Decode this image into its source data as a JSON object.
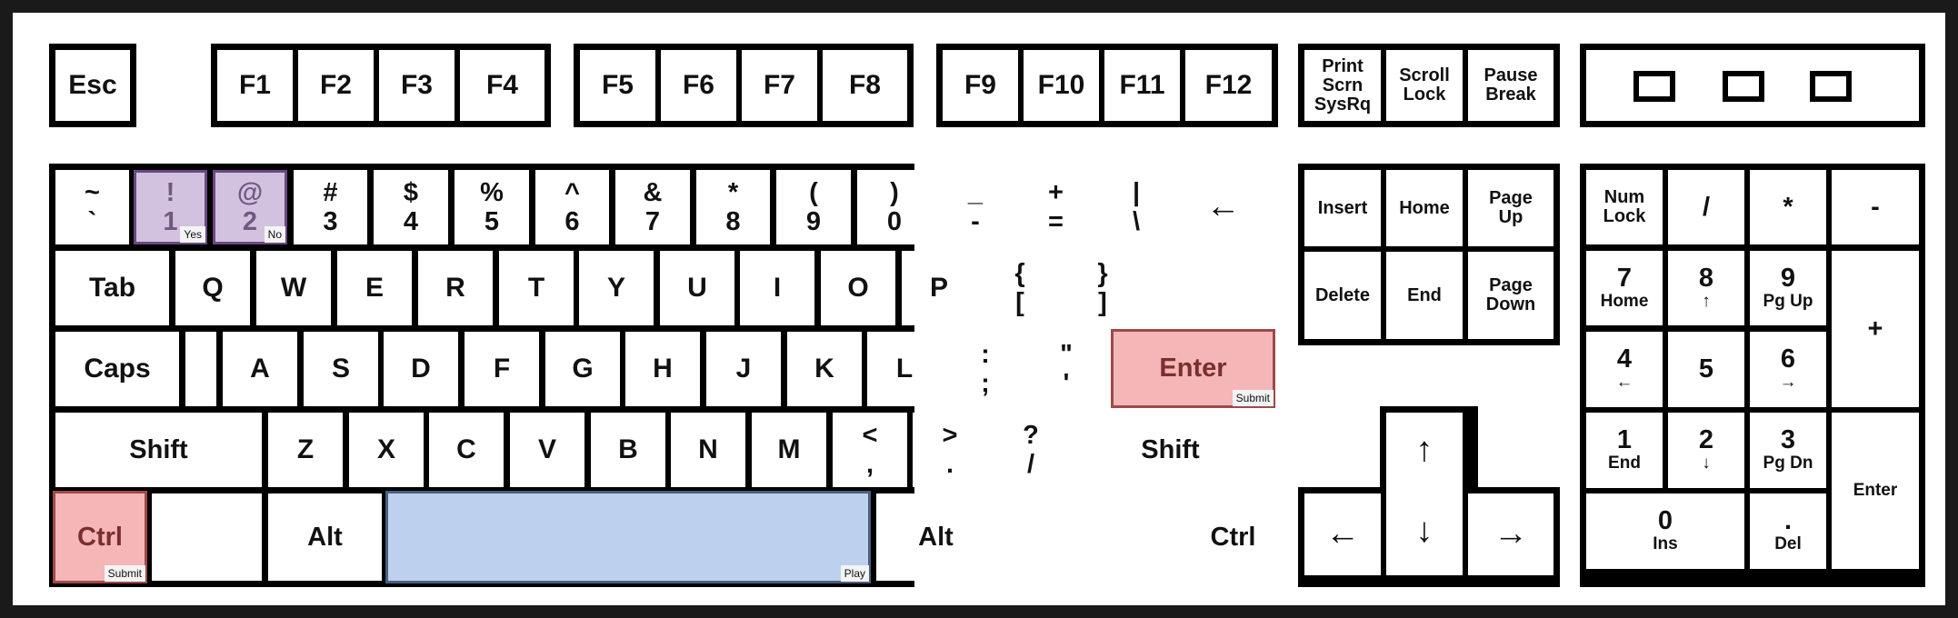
{
  "function_row": {
    "esc": "Esc",
    "f1": "F1",
    "f2": "F2",
    "f3": "F3",
    "f4": "F4",
    "f5": "F5",
    "f6": "F6",
    "f7": "F7",
    "f8": "F8",
    "f9": "F9",
    "f10": "F10",
    "f11": "F11",
    "f12": "F12",
    "print": [
      "Print",
      "Scrn",
      "SysRq"
    ],
    "scroll": [
      "Scroll",
      "Lock"
    ],
    "pause": [
      "Pause",
      "Break"
    ]
  },
  "number_row": {
    "tilde": [
      "~",
      "`"
    ],
    "k1": [
      "!",
      "1"
    ],
    "k2": [
      "@",
      "2"
    ],
    "k3": [
      "#",
      "3"
    ],
    "k4": [
      "$",
      "4"
    ],
    "k5": [
      "%",
      "5"
    ],
    "k6": [
      "^",
      "6"
    ],
    "k7": [
      "&",
      "7"
    ],
    "k8": [
      "*",
      "8"
    ],
    "k9": [
      "(",
      "9"
    ],
    "k0": [
      ")",
      "0"
    ],
    "minus": [
      "_",
      "-"
    ],
    "equals": [
      "+",
      "="
    ],
    "backslash": [
      "|",
      "\\"
    ],
    "backspace": "←"
  },
  "top_row": {
    "tab": "Tab",
    "q": "Q",
    "w": "W",
    "e": "E",
    "r": "R",
    "t": "T",
    "y": "Y",
    "u": "U",
    "i": "I",
    "o": "O",
    "p": "P",
    "lbracket": [
      "{",
      "["
    ],
    "rbracket": [
      "}",
      "]"
    ]
  },
  "home_row": {
    "caps": "Caps",
    "a": "A",
    "s": "S",
    "d": "D",
    "f": "F",
    "g": "G",
    "h": "H",
    "j": "J",
    "k": "K",
    "l": "L",
    "semicolon": [
      ":",
      ";"
    ],
    "quote": [
      "\"",
      "'"
    ],
    "enter": "Enter"
  },
  "bottom_row": {
    "lshift": "Shift",
    "z": "Z",
    "x": "X",
    "c": "C",
    "v": "V",
    "b": "B",
    "n": "N",
    "m": "M",
    "comma": [
      "<",
      ","
    ],
    "period": [
      ">",
      "."
    ],
    "slash": [
      "?",
      "/"
    ],
    "rshift": "Shift"
  },
  "space_row": {
    "lctrl": "Ctrl",
    "lalt": "Alt",
    "ralt": "Alt",
    "rctrl": "Ctrl"
  },
  "nav": {
    "insert": "Insert",
    "home": "Home",
    "pageup": [
      "Page",
      "Up"
    ],
    "delete": "Delete",
    "end": "End",
    "pagedown": [
      "Page",
      "Down"
    ],
    "up": "↑",
    "left": "←",
    "down": "↓",
    "right": "→"
  },
  "numpad": {
    "numlock": [
      "Num",
      "Lock"
    ],
    "divide": "/",
    "multiply": "*",
    "subtract": "-",
    "n7": [
      "7",
      "Home"
    ],
    "n8": [
      "8",
      "↑"
    ],
    "n9": [
      "9",
      "Pg Up"
    ],
    "add": "+",
    "n4": [
      "4",
      "←"
    ],
    "n5": "5",
    "n6": [
      "6",
      "→"
    ],
    "n1": [
      "1",
      "End"
    ],
    "n2": [
      "2",
      "↓"
    ],
    "n3": [
      "3",
      "Pg Dn"
    ],
    "enter": "Enter",
    "n0": [
      "0",
      "Ins"
    ],
    "decimal": [
      ".",
      "Del"
    ]
  },
  "tags": {
    "k1": "Yes",
    "k2": "No",
    "enter": "Submit",
    "lctrl": "Submit",
    "space": "Play"
  },
  "colors": {
    "purple_highlight": "#d3c2df",
    "red_highlight": "#f4b6b6",
    "blue_highlight": "#bdd1ee"
  }
}
